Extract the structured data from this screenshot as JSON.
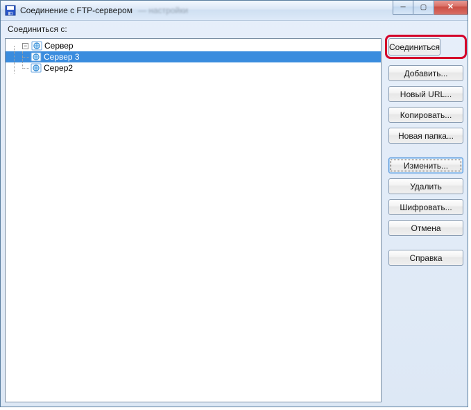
{
  "window": {
    "title": "Соединение с FTP-сервером",
    "blurred_suffix": "— настройки"
  },
  "labels": {
    "connect_to": "Соединиться с:"
  },
  "tree": {
    "root": {
      "label": "Сервер",
      "expanded": true,
      "selected": false
    },
    "children": [
      {
        "label": "Сервер 3",
        "selected": true
      },
      {
        "label": "Серер2",
        "selected": false
      }
    ]
  },
  "buttons": {
    "connect": "Соединиться",
    "add": "Добавить...",
    "new_url": "Новый URL...",
    "copy": "Копировать...",
    "new_folder": "Новая папка...",
    "edit": "Изменить...",
    "delete": "Удалить",
    "encrypt": "Шифровать...",
    "cancel": "Отмена",
    "help": "Справка"
  },
  "window_controls": {
    "minimize": "Minimize",
    "maximize": "Maximize",
    "close": "Close"
  }
}
